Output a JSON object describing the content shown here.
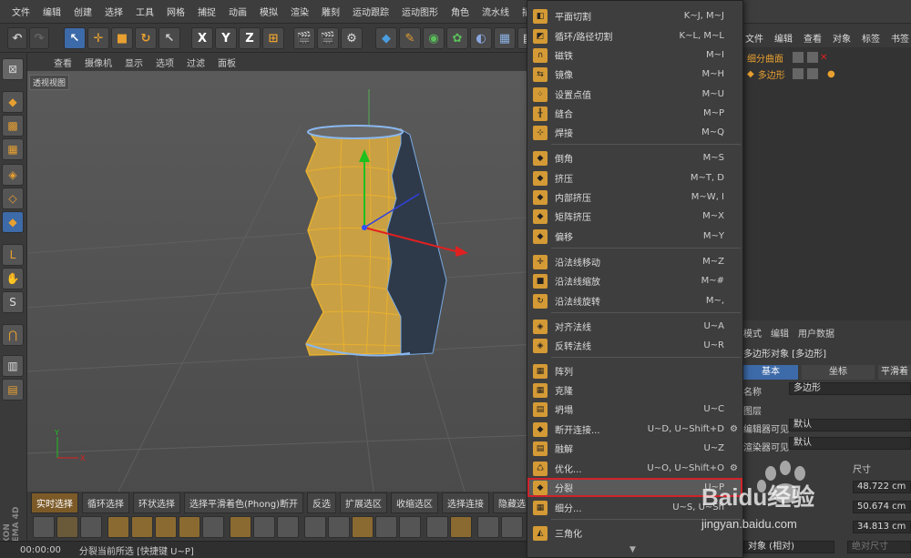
{
  "menubar": {
    "items": [
      "文件",
      "编辑",
      "创建",
      "选择",
      "工具",
      "网格",
      "捕捉",
      "动画",
      "模拟",
      "渲染",
      "雕刻",
      "运动跟踪",
      "运动图形",
      "角色",
      "流水线",
      "插件"
    ]
  },
  "viewport": {
    "menu": [
      "查看",
      "摄像机",
      "显示",
      "选项",
      "过滤",
      "面板"
    ],
    "label": "透视视图",
    "axis_y": "Y",
    "axis_x": "X"
  },
  "bottom_bar": {
    "buttons": [
      "实时选择",
      "循环选择",
      "环状选择",
      "选择平滑着色(Phong)断开",
      "反选",
      "扩展选区",
      "收缩选区",
      "选择连接",
      "隐藏选"
    ]
  },
  "status": {
    "time": "00:00:00",
    "message": "分裂当前所选 [快捷键 U~P]"
  },
  "context_menu": {
    "items": [
      {
        "label": "平面切割",
        "shortcut": "K~J, M~J"
      },
      {
        "label": "循环/路径切割",
        "shortcut": "K~L, M~L"
      },
      {
        "label": "磁铁",
        "shortcut": "M~I"
      },
      {
        "label": "镜像",
        "shortcut": "M~H"
      },
      {
        "label": "设置点值",
        "shortcut": "M~U"
      },
      {
        "label": "缝合",
        "shortcut": "M~P"
      },
      {
        "label": "焊接",
        "shortcut": "M~Q"
      },
      {
        "label": "倒角",
        "shortcut": "M~S"
      },
      {
        "label": "挤压",
        "shortcut": "M~T, D"
      },
      {
        "label": "内部挤压",
        "shortcut": "M~W, I"
      },
      {
        "label": "矩阵挤压",
        "shortcut": "M~X"
      },
      {
        "label": "偏移",
        "shortcut": "M~Y"
      },
      {
        "label": "沿法线移动",
        "shortcut": "M~Z"
      },
      {
        "label": "沿法线缩放",
        "shortcut": "M~#"
      },
      {
        "label": "沿法线旋转",
        "shortcut": "M~,"
      },
      {
        "label": "对齐法线",
        "shortcut": "U~A"
      },
      {
        "label": "反转法线",
        "shortcut": "U~R"
      },
      {
        "label": "阵列",
        "shortcut": ""
      },
      {
        "label": "克隆",
        "shortcut": ""
      },
      {
        "label": "坍塌",
        "shortcut": "U~C"
      },
      {
        "label": "断开连接...",
        "shortcut": "U~D, U~Shift+D"
      },
      {
        "label": "融解",
        "shortcut": "U~Z"
      },
      {
        "label": "优化...",
        "shortcut": "U~O, U~Shift+O"
      },
      {
        "label": "分裂",
        "shortcut": "U~P"
      },
      {
        "label": "细分...",
        "shortcut": "U~S, U~Sh"
      },
      {
        "label": "三角化",
        "shortcut": ""
      }
    ]
  },
  "object_manager": {
    "menu": [
      "文件",
      "编辑",
      "查看",
      "对象",
      "标签",
      "书签"
    ],
    "objects": [
      "细分曲面",
      "多边形"
    ]
  },
  "attributes": {
    "menu": [
      "模式",
      "编辑",
      "用户数据"
    ],
    "title": "多边形对象 [多边形]",
    "tabs": [
      "基本",
      "坐标",
      "平滑着"
    ],
    "name_label": "名称",
    "name_value": "多边形",
    "layer_label": "图层",
    "editor_visible_label": "编辑器可见",
    "editor_visible_value": "默认",
    "render_visible_label": "渲染器可见",
    "render_visible_value": "默认",
    "size_header": "尺寸",
    "sizes": [
      "48.722 cm",
      "50.674 cm",
      "34.813 cm"
    ],
    "relative_label": "对象 (相对)",
    "absolute_size_label": "绝对尺寸"
  },
  "watermark": {
    "brand": "Baidu经验",
    "url": "jingyan.baidu.com"
  },
  "colors": {
    "selection_orange": "#d49a35",
    "highlight_red": "#d0232b",
    "active_tab": "#3d6aa8"
  }
}
